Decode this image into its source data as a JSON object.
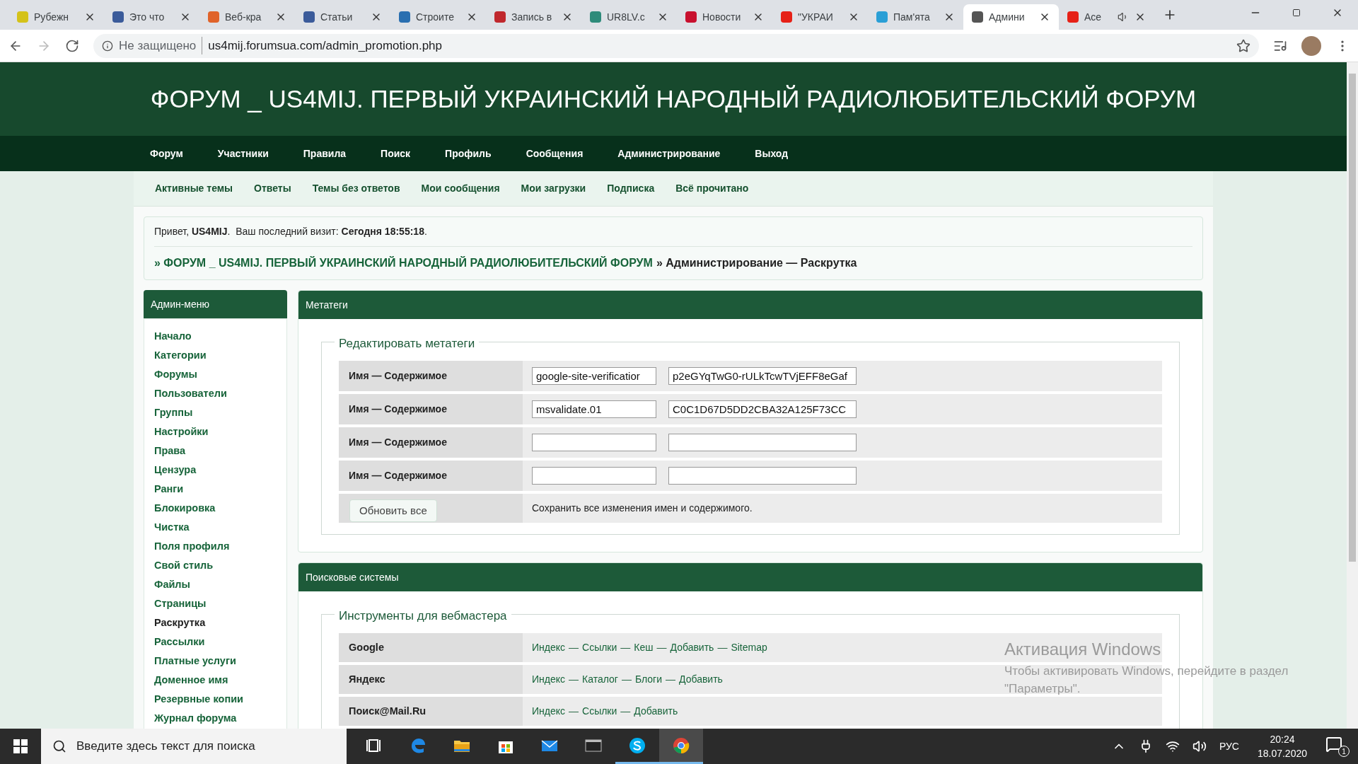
{
  "browser": {
    "tabs": [
      {
        "label": "Рубежн",
        "selected": false,
        "color": "#d4c21a"
      },
      {
        "label": "Это что",
        "selected": false,
        "color": "#3b5b9a"
      },
      {
        "label": "Веб-кра",
        "selected": false,
        "color": "#e0632a"
      },
      {
        "label": "Статьи",
        "selected": false,
        "color": "#3b5b9a"
      },
      {
        "label": "Строите",
        "selected": false,
        "color": "#2a6fb0"
      },
      {
        "label": "Запись в",
        "selected": false,
        "color": "#c0282d"
      },
      {
        "label": "UR8LV.c",
        "selected": false,
        "color": "#2e8b7a"
      },
      {
        "label": "Новости",
        "selected": false,
        "color": "#c8102e"
      },
      {
        "label": "\"УКРАИ",
        "selected": false,
        "color": "#e62117"
      },
      {
        "label": "Пам'ята",
        "selected": false,
        "color": "#2a9fd6"
      },
      {
        "label": "Админи",
        "selected": true,
        "color": "#555555"
      },
      {
        "label": "Асе",
        "selected": false,
        "color": "#e62117"
      }
    ],
    "security": "Не защищено",
    "url": "us4mij.forumsua.com/admin_promotion.php"
  },
  "forum_title": "ФОРУМ _ US4MIJ. ПЕРВЫЙ УКРАИНСКИЙ НАРОДНЫЙ РАДИОЛЮБИТЕЛЬСКИЙ ФОРУМ",
  "nav": [
    "Форум",
    "Участники",
    "Правила",
    "Поиск",
    "Профиль",
    "Сообщения",
    "Администрирование",
    "Выход"
  ],
  "subnav": [
    "Активные темы",
    "Ответы",
    "Темы без ответов",
    "Мои сообщения",
    "Мои загрузки",
    "Подписка",
    "Всё прочитано"
  ],
  "greeting": "Привет, **US4MIJ**.  Ваш последний визит: **Сегодня 18:55:18**.",
  "breadcrumb": {
    "link": "» ФОРУМ _ US4MIJ. ПЕРВЫЙ УКРАИНСКИЙ НАРОДНЫЙ РАДИОЛЮБИТЕЛЬСКИЙ ФОРУМ",
    "current": "» Администрирование — Раскрутка"
  },
  "sidebar": {
    "title": "Админ-меню",
    "items": [
      {
        "label": "Начало",
        "selected": false
      },
      {
        "label": "Категории",
        "selected": false
      },
      {
        "label": "Форумы",
        "selected": false
      },
      {
        "label": "Пользователи",
        "selected": false
      },
      {
        "label": "Группы",
        "selected": false
      },
      {
        "label": "Настройки",
        "selected": false
      },
      {
        "label": "Права",
        "selected": false
      },
      {
        "label": "Цензура",
        "selected": false
      },
      {
        "label": "Ранги",
        "selected": false
      },
      {
        "label": "Блокировка",
        "selected": false
      },
      {
        "label": "Чистка",
        "selected": false
      },
      {
        "label": "Поля профиля",
        "selected": false
      },
      {
        "label": "Свой стиль",
        "selected": false
      },
      {
        "label": "Файлы",
        "selected": false
      },
      {
        "label": "Страницы",
        "selected": false
      },
      {
        "label": "Раскрутка",
        "selected": true
      },
      {
        "label": "Рассылки",
        "selected": false
      },
      {
        "label": "Платные услуги",
        "selected": false
      },
      {
        "label": "Доменное имя",
        "selected": false
      },
      {
        "label": "Резервные копии",
        "selected": false
      },
      {
        "label": "Журнал форума",
        "selected": false
      }
    ]
  },
  "metatags": {
    "title": "Метатеги",
    "legend": "Редактировать метатеги",
    "rows": [
      {
        "label": "Имя — Содержимое",
        "name": "google-site-verificatior",
        "content": "p2eGYqTwG0-rULkTcwTVjEFF8eGaf"
      },
      {
        "label": "Имя — Содержимое",
        "name": "msvalidate.01",
        "content": "C0C1D67D5DD2CBA32A125F73CC"
      },
      {
        "label": "Имя — Содержимое"
      },
      {
        "label": "Имя — Содержимое"
      }
    ],
    "button": "Обновить все",
    "note": "Сохранить все изменения имен и содержимого."
  },
  "search_systems": {
    "title": "Поисковые системы",
    "legend": "Инструменты для вебмастера",
    "separator": "—",
    "rows": [
      {
        "name": "Google",
        "links": [
          "Индекс",
          "Ссылки",
          "Кеш",
          "Добавить",
          "Sitemap"
        ]
      },
      {
        "name": "Яндекс",
        "links": [
          "Индекс",
          "Каталог",
          "Блоги",
          "Добавить"
        ]
      },
      {
        "name": "Поиск@Mail.Ru",
        "links": [
          "Индекс",
          "Ссылки",
          "Добавить"
        ]
      }
    ]
  },
  "activation": {
    "title": "Активация Windows",
    "text": "Чтобы активировать Windows, перейдите в раздел \"Параметры\"."
  },
  "taskbar": {
    "search_placeholder": "Введите здесь текст для поиска",
    "apps": [
      {
        "kind": "task-view",
        "running": false,
        "selected": false
      },
      {
        "kind": "edge",
        "running": false,
        "selected": false
      },
      {
        "kind": "explorer",
        "running": false,
        "selected": false
      },
      {
        "kind": "store",
        "running": false,
        "selected": false
      },
      {
        "kind": "mail",
        "running": false,
        "selected": false
      },
      {
        "kind": "terminal",
        "running": false,
        "selected": false
      },
      {
        "kind": "skype",
        "running": true,
        "selected": false
      },
      {
        "kind": "chrome",
        "running": true,
        "selected": true
      }
    ],
    "language": "РУС",
    "time": "20:24",
    "date": "18.07.2020",
    "notifications": "1"
  }
}
